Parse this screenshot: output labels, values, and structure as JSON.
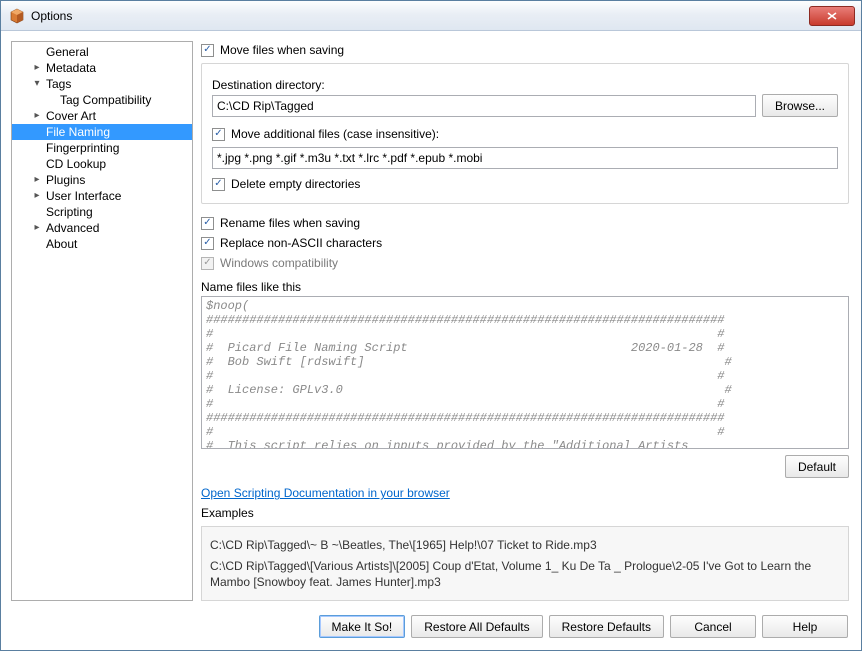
{
  "window": {
    "title": "Options"
  },
  "tree": [
    {
      "label": "General",
      "indent": 1,
      "toggle": "",
      "selected": false
    },
    {
      "label": "Metadata",
      "indent": 1,
      "toggle": "▸",
      "selected": false
    },
    {
      "label": "Tags",
      "indent": 1,
      "toggle": "▾",
      "selected": false
    },
    {
      "label": "Tag Compatibility",
      "indent": 2,
      "toggle": "",
      "selected": false
    },
    {
      "label": "Cover Art",
      "indent": 1,
      "toggle": "▸",
      "selected": false
    },
    {
      "label": "File Naming",
      "indent": 1,
      "toggle": "",
      "selected": true
    },
    {
      "label": "Fingerprinting",
      "indent": 1,
      "toggle": "",
      "selected": false
    },
    {
      "label": "CD Lookup",
      "indent": 1,
      "toggle": "",
      "selected": false
    },
    {
      "label": "Plugins",
      "indent": 1,
      "toggle": "▸",
      "selected": false
    },
    {
      "label": "User Interface",
      "indent": 1,
      "toggle": "▸",
      "selected": false
    },
    {
      "label": "Scripting",
      "indent": 1,
      "toggle": "",
      "selected": false
    },
    {
      "label": "Advanced",
      "indent": 1,
      "toggle": "▸",
      "selected": false
    },
    {
      "label": "About",
      "indent": 1,
      "toggle": "",
      "selected": false
    }
  ],
  "main": {
    "moveFiles": {
      "label": "Move files when saving",
      "checked": true
    },
    "destLabel": "Destination directory:",
    "destValue": "C:\\CD Rip\\Tagged",
    "browse": "Browse...",
    "moveAdditional": {
      "label": "Move additional files (case insensitive):",
      "checked": true
    },
    "additionalPatterns": "*.jpg *.png *.gif *.m3u *.txt *.lrc *.pdf *.epub *.mobi",
    "deleteEmpty": {
      "label": "Delete empty directories",
      "checked": true
    },
    "renameFiles": {
      "label": "Rename files when saving",
      "checked": true
    },
    "replaceNonAscii": {
      "label": "Replace non-ASCII characters",
      "checked": true
    },
    "windowsCompat": {
      "label": "Windows compatibility",
      "checked": true,
      "disabled": true
    },
    "nameFilesLabel": "Name files like this",
    "script": "$noop(\n########################################################################\n#                                                                      #\n#  Picard File Naming Script                               2020-01-28  #\n#  Bob Swift [rdswift]                                                  #\n#                                                                      #\n#  License: GPLv3.0                                                     #\n#                                                                      #\n########################################################################\n#                                                                      #\n#  This script relies on inputs provided by the \"Additional Artists   ",
    "defaultBtn": "Default",
    "docsLink": "Open Scripting Documentation in your browser",
    "examplesLabel": "Examples",
    "examples": [
      "C:\\CD Rip\\Tagged\\~ B ~\\Beatles, The\\[1965] Help!\\07 Ticket to Ride.mp3",
      "C:\\CD Rip\\Tagged\\[Various Artists]\\[2005] Coup d'Etat, Volume 1_ Ku De Ta _ Prologue\\2-05 I've Got to Learn the Mambo [Snowboy feat. James Hunter].mp3"
    ]
  },
  "footer": {
    "makeItSo": "Make It So!",
    "restoreAll": "Restore All Defaults",
    "restore": "Restore Defaults",
    "cancel": "Cancel",
    "help": "Help"
  }
}
